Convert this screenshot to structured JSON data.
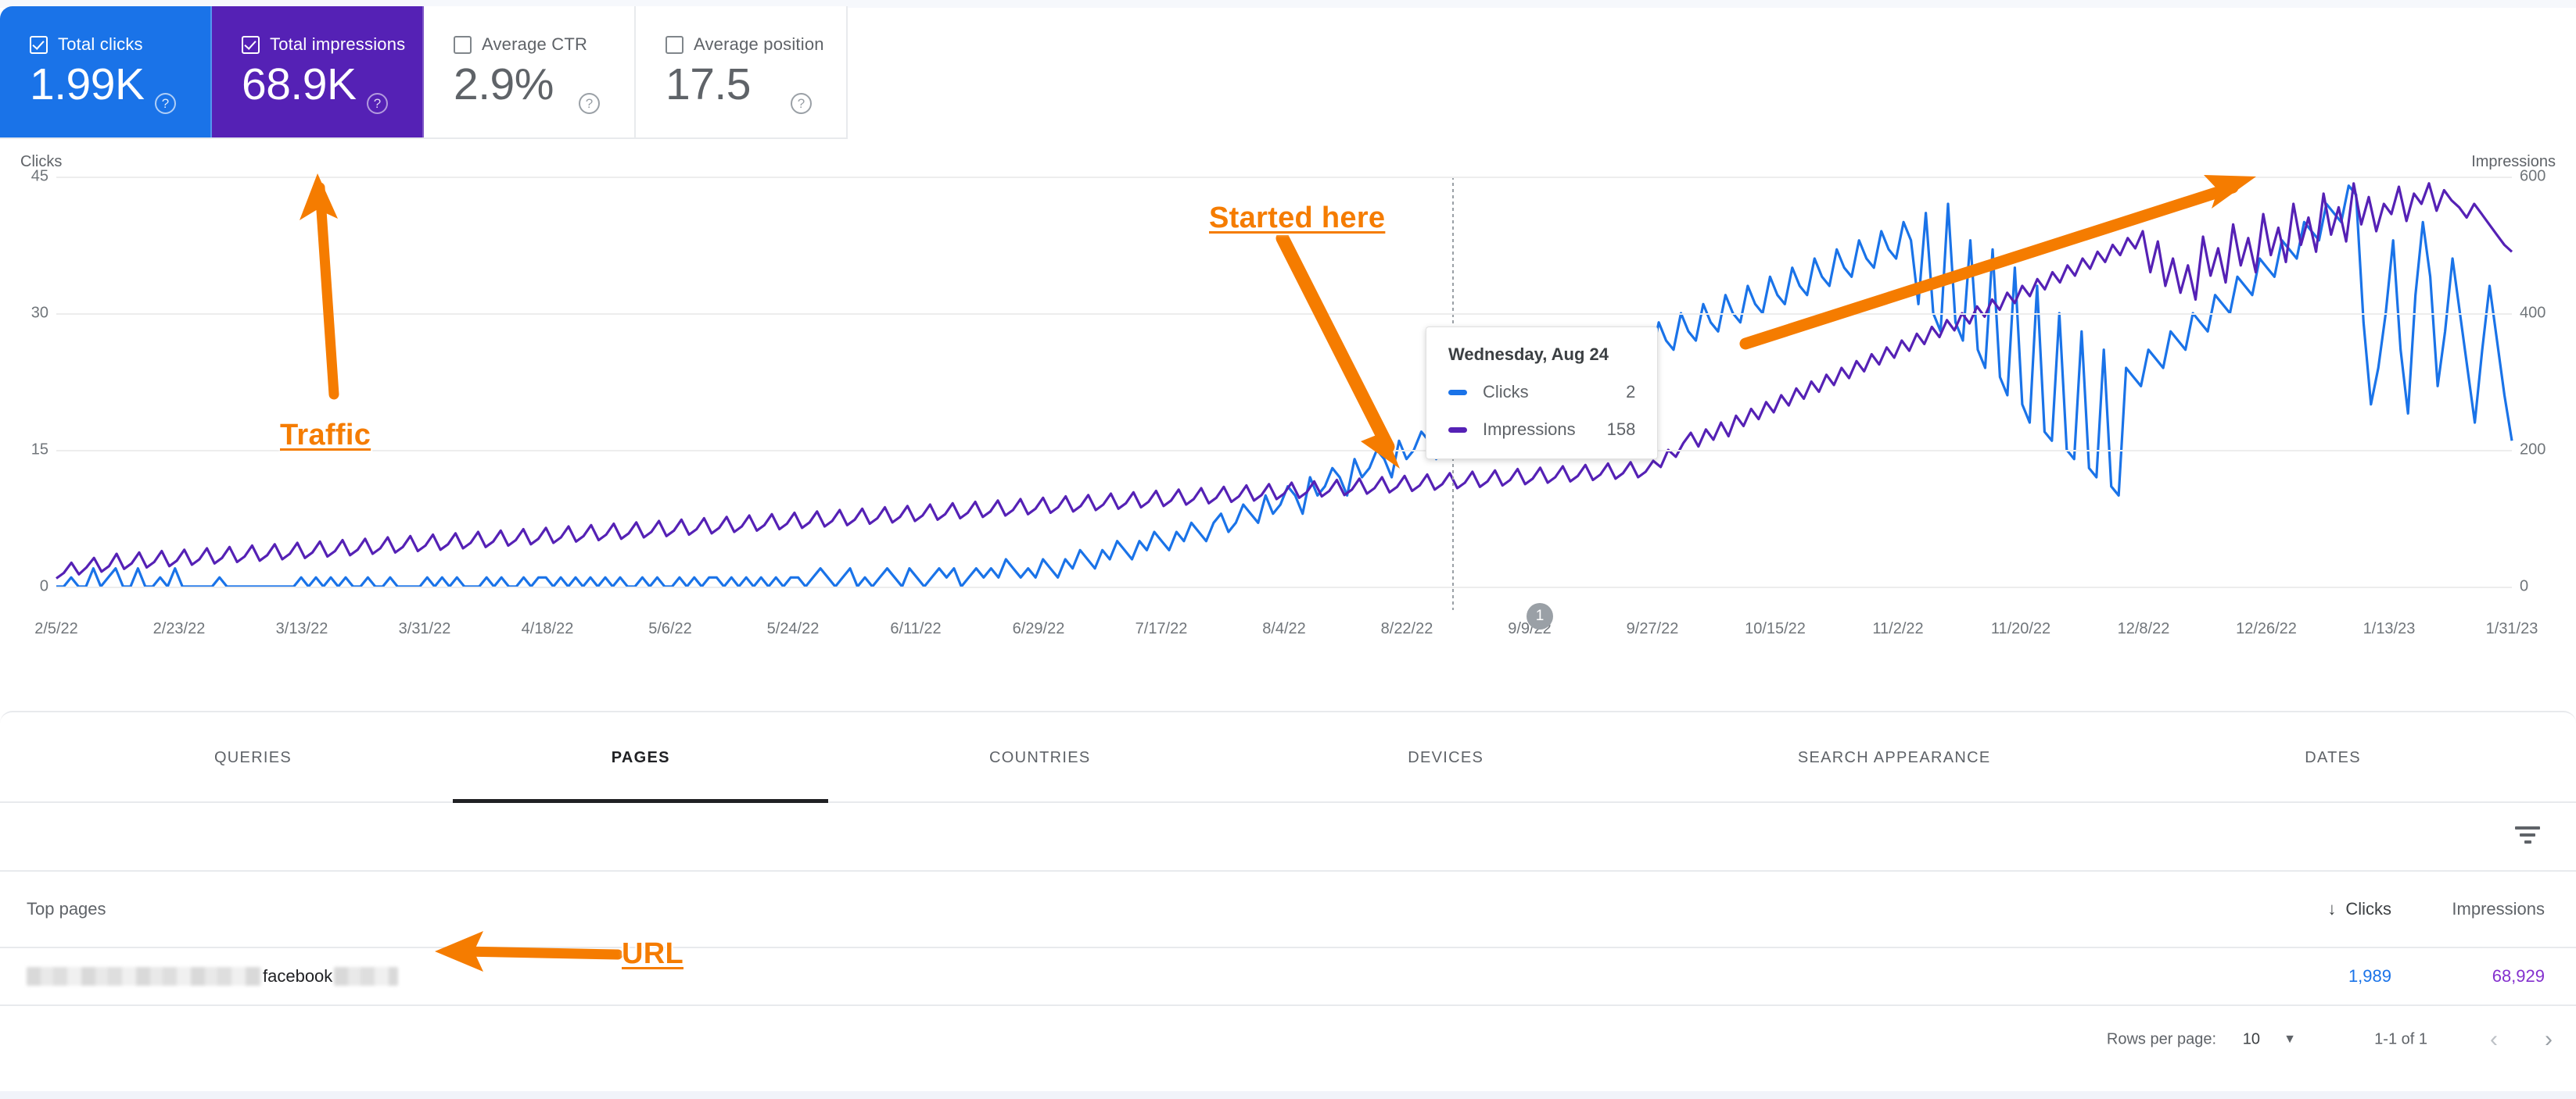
{
  "metric_cards": [
    {
      "label": "Total clicks",
      "value": "1.99K",
      "checked": true,
      "active": true,
      "color": "#1a73e8"
    },
    {
      "label": "Total impressions",
      "value": "68.9K",
      "checked": true,
      "active": true,
      "color": "#5521b5"
    },
    {
      "label": "Average CTR",
      "value": "2.9%",
      "checked": false,
      "active": false,
      "color": "#5f6368"
    },
    {
      "label": "Average position",
      "value": "17.5",
      "checked": false,
      "active": false,
      "color": "#5f6368"
    }
  ],
  "help_icon": "help-circle-icon",
  "chart_data": {
    "type": "line",
    "title": "",
    "xlabel": "",
    "left_axis": {
      "label": "Clicks",
      "ticks": [
        0,
        15,
        30,
        45
      ],
      "ylim": [
        0,
        45
      ],
      "color": "#1a73e8"
    },
    "right_axis": {
      "label": "Impressions",
      "ticks": [
        0,
        200,
        400,
        600
      ],
      "ylim": [
        0,
        600
      ],
      "color": "#5521b5"
    },
    "grid": true,
    "legend": [
      "Clicks",
      "Impressions"
    ],
    "xticks": [
      "2/5/22",
      "2/23/22",
      "3/13/22",
      "3/31/22",
      "4/18/22",
      "5/6/22",
      "5/24/22",
      "6/11/22",
      "6/29/22",
      "7/17/22",
      "8/4/22",
      "8/22/22",
      "9/9/22",
      "9/27/22",
      "10/15/22",
      "11/2/22",
      "11/20/22",
      "12/8/22",
      "12/26/22",
      "1/13/23",
      "1/31/23"
    ],
    "series": [
      {
        "name": "Clicks",
        "color": "#1a73e8",
        "axis": "left",
        "values": [
          0,
          0,
          1,
          0,
          0,
          2,
          0,
          1,
          2,
          0,
          0,
          2,
          0,
          0,
          1,
          0,
          2,
          0,
          0,
          0,
          0,
          0,
          1,
          0,
          0,
          0,
          0,
          0,
          0,
          0,
          0,
          0,
          0,
          1,
          0,
          1,
          0,
          1,
          0,
          1,
          0,
          0,
          1,
          0,
          0,
          1,
          0,
          0,
          0,
          0,
          1,
          0,
          1,
          0,
          1,
          0,
          0,
          0,
          1,
          0,
          1,
          0,
          0,
          1,
          0,
          1,
          1,
          0,
          1,
          0,
          1,
          0,
          1,
          0,
          1,
          0,
          1,
          0,
          0,
          1,
          0,
          1,
          0,
          0,
          1,
          0,
          1,
          0,
          1,
          1,
          0,
          1,
          0,
          1,
          0,
          1,
          0,
          1,
          0,
          1,
          1,
          0,
          1,
          2,
          1,
          0,
          1,
          2,
          0,
          1,
          0,
          1,
          2,
          1,
          0,
          2,
          1,
          0,
          1,
          2,
          1,
          2,
          0,
          1,
          2,
          1,
          2,
          1,
          3,
          2,
          1,
          2,
          1,
          3,
          2,
          1,
          3,
          2,
          4,
          3,
          2,
          4,
          3,
          5,
          4,
          3,
          5,
          4,
          6,
          5,
          4,
          6,
          5,
          7,
          6,
          5,
          7,
          8,
          6,
          7,
          9,
          8,
          7,
          10,
          8,
          9,
          11,
          10,
          8,
          12,
          10,
          11,
          13,
          12,
          10,
          14,
          12,
          13,
          15,
          14,
          12,
          16,
          14,
          15,
          17,
          16,
          14,
          18,
          16,
          17,
          19,
          18,
          16,
          20,
          18,
          19,
          21,
          20,
          18,
          22,
          20,
          21,
          23,
          22,
          20,
          24,
          22,
          26,
          24,
          23,
          27,
          25,
          24,
          28,
          26,
          25,
          29,
          27,
          26,
          30,
          28,
          27,
          31,
          29,
          28,
          32,
          30,
          29,
          33,
          31,
          30,
          34,
          32,
          31,
          35,
          33,
          32,
          36,
          34,
          33,
          37,
          35,
          34,
          38,
          36,
          35,
          39,
          37,
          36,
          40,
          38,
          31,
          41,
          30,
          28,
          42,
          29,
          27,
          38,
          26,
          24,
          37,
          23,
          21,
          35,
          20,
          18,
          33,
          17,
          16,
          30,
          15,
          14,
          28,
          13,
          12,
          26,
          11,
          10,
          24,
          23,
          22,
          26,
          25,
          24,
          28,
          27,
          26,
          30,
          29,
          28,
          32,
          31,
          30,
          34,
          33,
          32,
          36,
          35,
          34,
          38,
          37,
          36,
          40,
          39,
          38,
          42,
          41,
          40,
          44,
          43,
          29,
          20,
          24,
          30,
          38,
          26,
          19,
          32,
          40,
          34,
          22,
          28,
          36,
          30,
          24,
          18,
          26,
          33,
          27,
          21,
          16
        ]
      },
      {
        "name": "Impressions",
        "color": "#5521b5",
        "axis": "right",
        "values": [
          12,
          20,
          35,
          18,
          28,
          42,
          22,
          30,
          48,
          26,
          34,
          50,
          28,
          36,
          52,
          30,
          38,
          54,
          32,
          40,
          56,
          34,
          42,
          58,
          36,
          44,
          60,
          38,
          46,
          62,
          40,
          48,
          64,
          42,
          50,
          66,
          44,
          52,
          68,
          46,
          54,
          70,
          48,
          56,
          72,
          50,
          58,
          74,
          52,
          60,
          76,
          54,
          62,
          78,
          56,
          64,
          80,
          58,
          66,
          82,
          60,
          68,
          84,
          62,
          70,
          86,
          64,
          72,
          88,
          66,
          74,
          90,
          68,
          76,
          92,
          70,
          78,
          94,
          72,
          80,
          96,
          74,
          82,
          98,
          76,
          84,
          100,
          78,
          86,
          102,
          80,
          88,
          104,
          82,
          90,
          106,
          84,
          92,
          108,
          86,
          94,
          110,
          88,
          96,
          112,
          90,
          98,
          114,
          92,
          100,
          116,
          94,
          102,
          118,
          96,
          104,
          120,
          98,
          106,
          122,
          100,
          108,
          124,
          102,
          110,
          126,
          104,
          112,
          128,
          106,
          114,
          130,
          108,
          116,
          132,
          110,
          118,
          134,
          112,
          120,
          136,
          114,
          122,
          138,
          116,
          124,
          140,
          118,
          126,
          142,
          120,
          128,
          144,
          122,
          130,
          146,
          124,
          132,
          148,
          126,
          134,
          150,
          128,
          136,
          152,
          130,
          138,
          154,
          132,
          140,
          156,
          134,
          142,
          158,
          136,
          144,
          160,
          138,
          146,
          162,
          140,
          148,
          164,
          142,
          150,
          166,
          144,
          152,
          168,
          146,
          154,
          170,
          148,
          156,
          172,
          150,
          158,
          174,
          152,
          160,
          176,
          154,
          162,
          178,
          156,
          164,
          180,
          158,
          166,
          182,
          160,
          168,
          184,
          175,
          200,
          190,
          210,
          225,
          205,
          230,
          215,
          240,
          220,
          250,
          235,
          260,
          245,
          270,
          255,
          280,
          265,
          290,
          275,
          300,
          285,
          310,
          295,
          320,
          305,
          330,
          315,
          340,
          325,
          350,
          335,
          360,
          345,
          370,
          355,
          380,
          365,
          390,
          375,
          400,
          385,
          410,
          395,
          420,
          405,
          430,
          415,
          440,
          425,
          450,
          435,
          460,
          445,
          470,
          455,
          480,
          465,
          490,
          475,
          500,
          485,
          510,
          495,
          520,
          460,
          505,
          440,
          480,
          430,
          470,
          420,
          512,
          455,
          495,
          445,
          530,
          470,
          510,
          460,
          545,
          485,
          525,
          475,
          560,
          500,
          540,
          490,
          575,
          515,
          555,
          505,
          590,
          530,
          570,
          520,
          560,
          545,
          585,
          535,
          575,
          560,
          590,
          550,
          580,
          565,
          555,
          540,
          560,
          545,
          530,
          515,
          500,
          490
        ]
      }
    ],
    "hover_tooltip": {
      "date": "Wednesday, Aug 24",
      "rows": [
        {
          "name": "Clicks",
          "value": "2",
          "color": "#1a73e8"
        },
        {
          "name": "Impressions",
          "value": "158",
          "color": "#5521b5"
        }
      ]
    },
    "annotation_marker": {
      "label": "1"
    }
  },
  "tabs": [
    {
      "label": "QUERIES",
      "active": false
    },
    {
      "label": "PAGES",
      "active": true
    },
    {
      "label": "COUNTRIES",
      "active": false
    },
    {
      "label": "DEVICES",
      "active": false
    },
    {
      "label": "SEARCH APPEARANCE",
      "active": false
    },
    {
      "label": "DATES",
      "active": false
    }
  ],
  "filter_icon": "filter-funnel-icon",
  "table": {
    "columns": {
      "primary": "Top pages",
      "clicks": "Clicks",
      "impressions": "Impressions"
    },
    "sort_indicator": "↓",
    "rows": [
      {
        "url_visible_text": "facebook",
        "clicks": "1,989",
        "impressions": "68,929"
      }
    ]
  },
  "pagination": {
    "rows_per_page_label": "Rows per page:",
    "rows_per_page_value": "10",
    "caret": "▼",
    "range": "1-1 of 1",
    "prev": "‹",
    "next": "›"
  },
  "annotations": [
    {
      "id": "traffic",
      "text": "Traffic"
    },
    {
      "id": "started-here",
      "text": "Started here"
    },
    {
      "id": "url",
      "text": "URL"
    }
  ],
  "annotation_color": "#f57c00"
}
